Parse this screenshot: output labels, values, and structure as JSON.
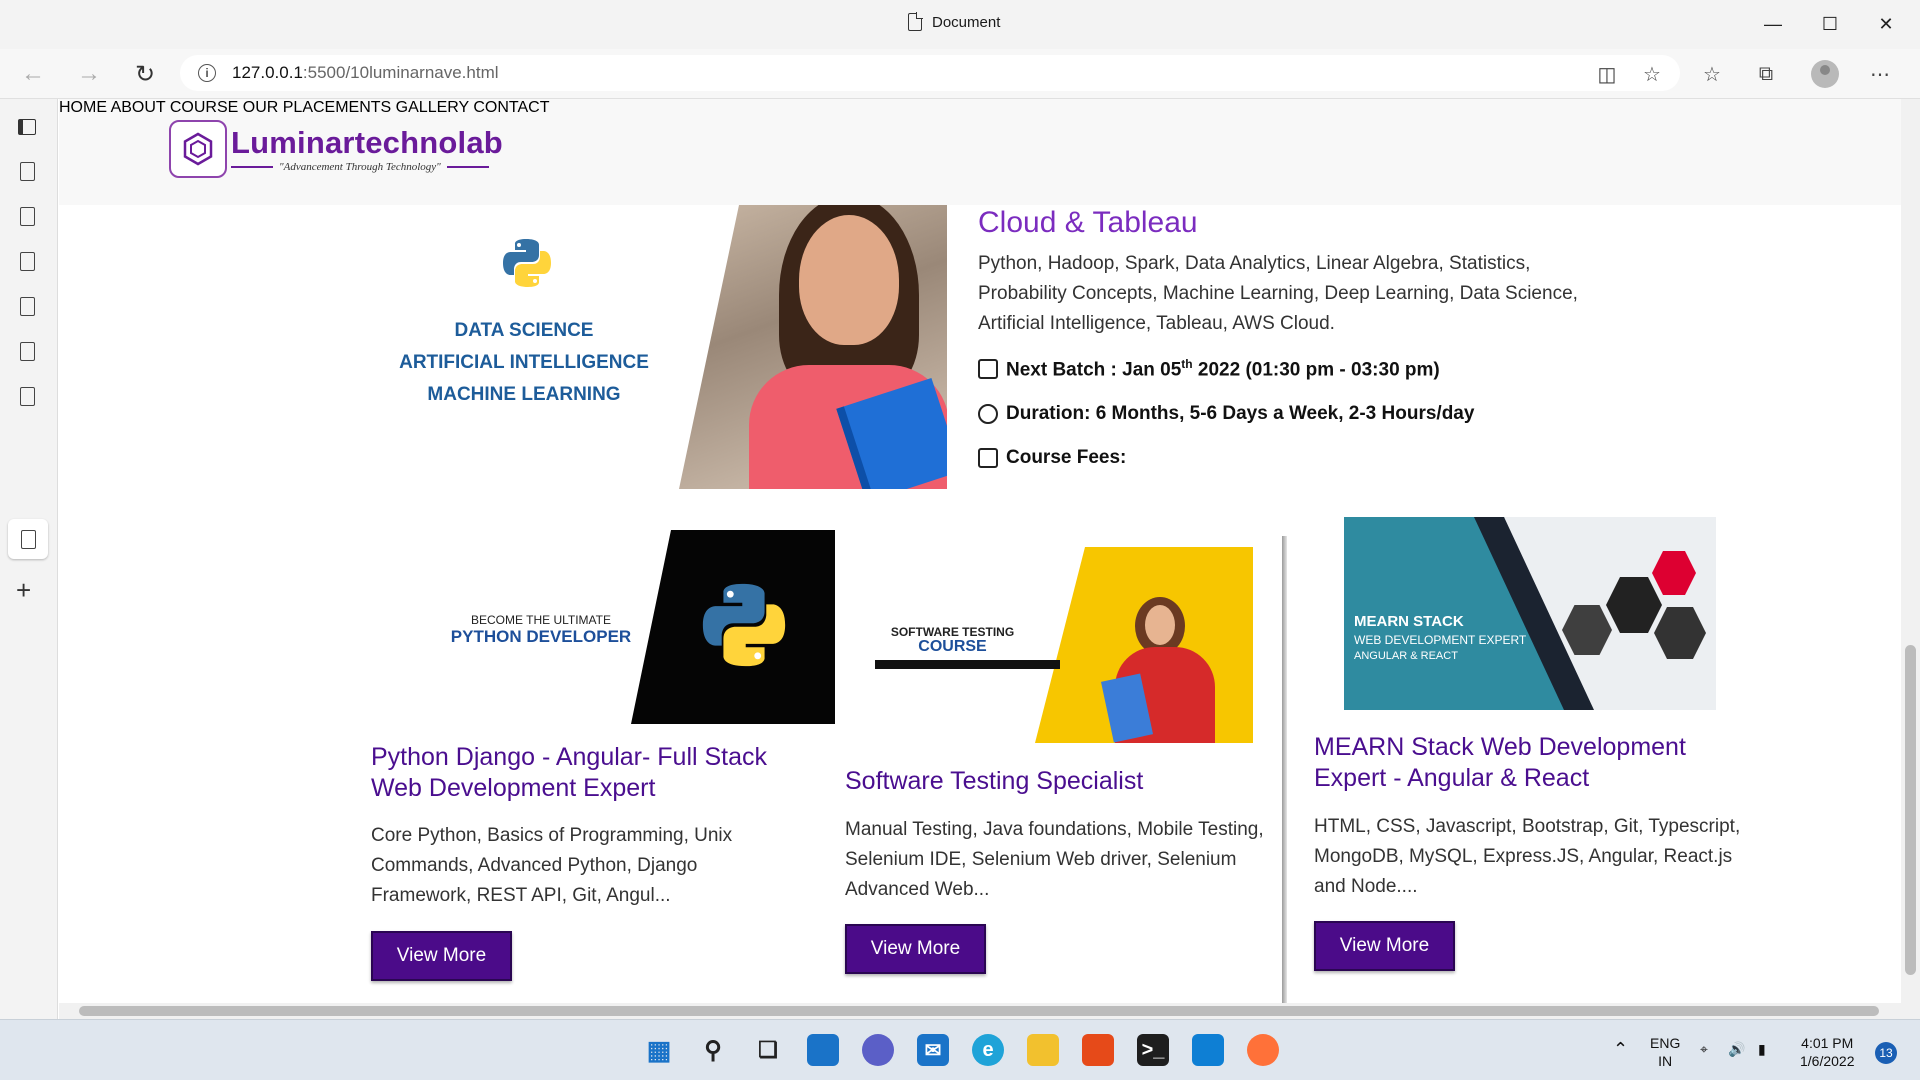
{
  "window": {
    "title": "Document"
  },
  "browser": {
    "url_host": "127.0.0.1",
    "url_rest": ":5500/10luminarnave.html"
  },
  "site": {
    "logo_name": "Luminartechnolab",
    "logo_tagline": "\"Advancement Through Technology\"",
    "nav": [
      "HOME",
      "ABOUT",
      "COURSE",
      "OUR PLACEMENTS",
      "GALLERY",
      "CONTACT"
    ]
  },
  "hero": {
    "image_lines": [
      "DATA SCIENCE",
      "ARTIFICIAL INTELLIGENCE",
      "MACHINE LEARNING"
    ],
    "title": "Cloud & Tableau",
    "description": "Python, Hadoop, Spark, Data Analytics, Linear Algebra, Statistics, Probability Concepts, Machine Learning, Deep Learning, Data Science, Artificial Intelligence, Tableau, AWS Cloud.",
    "batch_prefix": "Next Batch : Jan 05",
    "batch_sup": "th",
    "batch_suffix": " 2022 (01:30 pm - 03:30 pm)",
    "duration": "Duration: 6 Months, 5-6 Days a Week, 2-3 Hours/day",
    "fees": "Course Fees:"
  },
  "courses": [
    {
      "image_line1": "BECOME THE ULTIMATE",
      "image_line2": "PYTHON DEVELOPER",
      "title": "Python Django - Angular- Full Stack Web Development Expert",
      "description": "Core Python, Basics of Programming, Unix Commands, Advanced Python, Django Framework, REST API, Git, Angul...",
      "button": "View More"
    },
    {
      "image_line1": "SOFTWARE TESTING",
      "image_line2": "COURSE",
      "title": "Software Testing Specialist",
      "description": "Manual Testing, Java foundations, Mobile Testing, Selenium IDE, Selenium Web driver, Selenium Advanced Web...",
      "button": "View More"
    },
    {
      "image_line1": "MEARN STACK",
      "image_line2": "WEB DEVELOPMENT EXPERT",
      "image_line3": "ANGULAR & REACT",
      "title": "MEARN Stack Web Development Expert - Angular & React",
      "description": "HTML, CSS, Javascript, Bootstrap, Git, Typescript, MongoDB, MySQL, Express.JS, Angular, React.js and Node....",
      "button": "View More"
    }
  ],
  "taskbar": {
    "lang_line1": "ENG",
    "lang_line2": "IN",
    "time": "4:01 PM",
    "date": "1/6/2022",
    "notifications": "13"
  },
  "colors": {
    "accent": "#4b0b89",
    "brand": "#6a1b9a",
    "title": "#7b2cbf"
  }
}
